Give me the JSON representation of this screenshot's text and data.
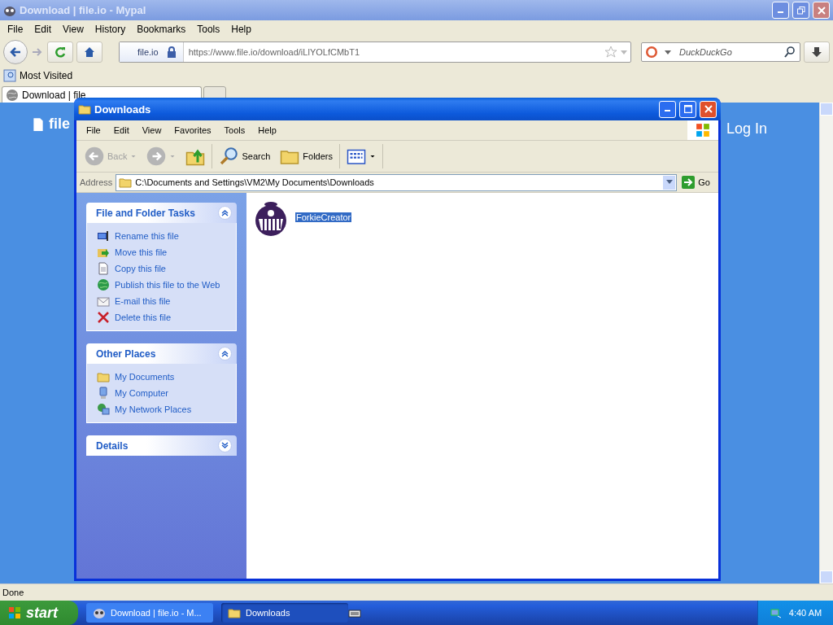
{
  "browser": {
    "title": "Download | file.io - Mypal",
    "menu": [
      "File",
      "Edit",
      "View",
      "History",
      "Bookmarks",
      "Tools",
      "Help"
    ],
    "identity": "file.io",
    "url": "https://www.file.io/download/iLlYOLfCMbT1",
    "search": {
      "placeholder": "DuckDuckGo"
    },
    "bookmarks": [
      "Most Visited"
    ],
    "tabs": [
      {
        "label": "Download | file",
        "selected": true
      }
    ],
    "page": {
      "logo": "file",
      "login": "Log In"
    },
    "status": "Done"
  },
  "explorer": {
    "title": "Downloads",
    "menu": [
      "File",
      "Edit",
      "View",
      "Favorites",
      "Tools",
      "Help"
    ],
    "toolbar": [
      {
        "kind": "back",
        "label": "Back",
        "disabled": true
      },
      {
        "kind": "forward",
        "disabled": true
      },
      {
        "kind": "up",
        "disabled": false
      },
      {
        "kind": "search",
        "label": "Search",
        "disabled": false
      },
      {
        "kind": "folders",
        "label": "Folders",
        "disabled": false
      },
      {
        "kind": "views",
        "disabled": false
      }
    ],
    "address": {
      "label": "Address",
      "path": "C:\\Documents and Settings\\VM2\\My Documents\\Downloads",
      "go": "Go"
    },
    "panels": [
      {
        "title": "File and Folder Tasks",
        "expanded": true,
        "items": [
          {
            "kind": "rename",
            "label": "Rename this file"
          },
          {
            "kind": "move",
            "label": "Move this file"
          },
          {
            "kind": "copy",
            "label": "Copy this file"
          },
          {
            "kind": "publish",
            "label": "Publish this file to the Web"
          },
          {
            "kind": "email",
            "label": "E-mail this file"
          },
          {
            "kind": "delete",
            "label": "Delete this file"
          }
        ]
      },
      {
        "title": "Other Places",
        "expanded": true,
        "items": [
          {
            "kind": "documents",
            "label": "My Documents"
          },
          {
            "kind": "computer",
            "label": "My Computer"
          },
          {
            "kind": "network",
            "label": "My Network Places"
          }
        ]
      },
      {
        "title": "Details",
        "expanded": false
      }
    ],
    "files": [
      {
        "name": "ForkieCreator",
        "selected": true
      }
    ]
  },
  "taskbar": {
    "start": "start",
    "tasks": [
      {
        "kind": "browser",
        "label": "Download | file.io - M...",
        "selected": false
      },
      {
        "kind": "folder",
        "label": "Downloads",
        "selected": true
      }
    ],
    "clock": "4:40 AM"
  }
}
